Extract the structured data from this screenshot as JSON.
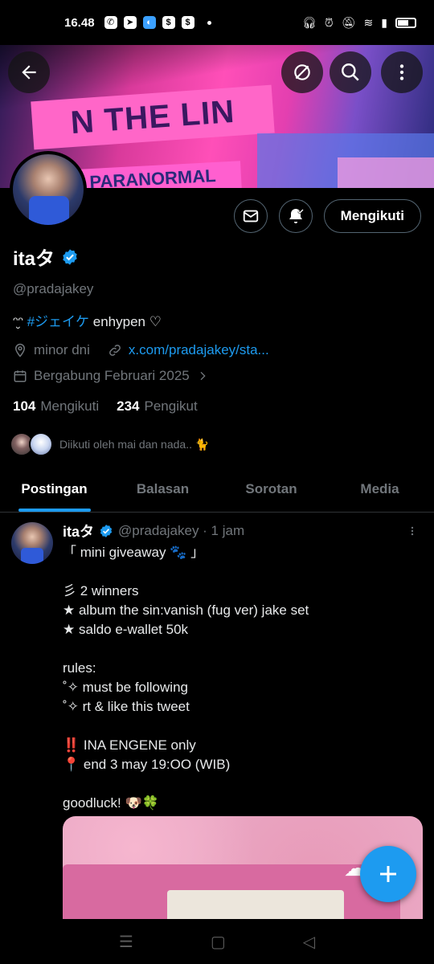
{
  "status_bar": {
    "time": "16.48",
    "notif_icons": [
      "whatsapp-icon",
      "telegram-icon",
      "app-icon",
      "shop-icon",
      "shop-icon"
    ],
    "right_icons": [
      "headphones-icon",
      "alarm-icon",
      "mute-icon",
      "wifi-icon",
      "signal-icon",
      "battery-icon"
    ]
  },
  "banner": {
    "text_top": "N THE LIN",
    "text_bottom": "PARANORMAL"
  },
  "profile": {
    "name": "itaタ",
    "handle": "@pradajakey",
    "bio_prefix": "ᵔ̮ᵔ ",
    "bio_hashtag": "#ジェイケ",
    "bio_suffix": " enhypen ♡",
    "location": "minor dni",
    "link": "x.com/pradajakey/sta...",
    "joined": "Bergabung Februari 2025",
    "following_count": "104",
    "following_label": "Mengikuti",
    "followers_count": "234",
    "followers_label": "Pengikut",
    "followed_by": "Diikuti oleh mai dan nada.. 🐈"
  },
  "actions": {
    "follow_label": "Mengikuti"
  },
  "tabs": [
    {
      "label": "Postingan",
      "active": true
    },
    {
      "label": "Balasan",
      "active": false
    },
    {
      "label": "Sorotan",
      "active": false
    },
    {
      "label": "Media",
      "active": false
    }
  ],
  "tweet": {
    "name": "itaタ",
    "meta": "@pradajakey · 1 jam",
    "body": "「 mini giveaway 🐾 」\n\n彡 2 winners\n★ album the sin:vanish (fug ver) jake set\n★ saldo e-wallet 50k\n\nrules:\n˚✧ must be following\n˚✧ rt & like this tweet\n\n‼️ INA ENGENE only\n📍 end 3 may 19:OO (WIB)\n\ngoodluck! 🐶🍀"
  },
  "colors": {
    "accent": "#1d9bf0",
    "background": "#000000",
    "muted": "#71767b"
  }
}
